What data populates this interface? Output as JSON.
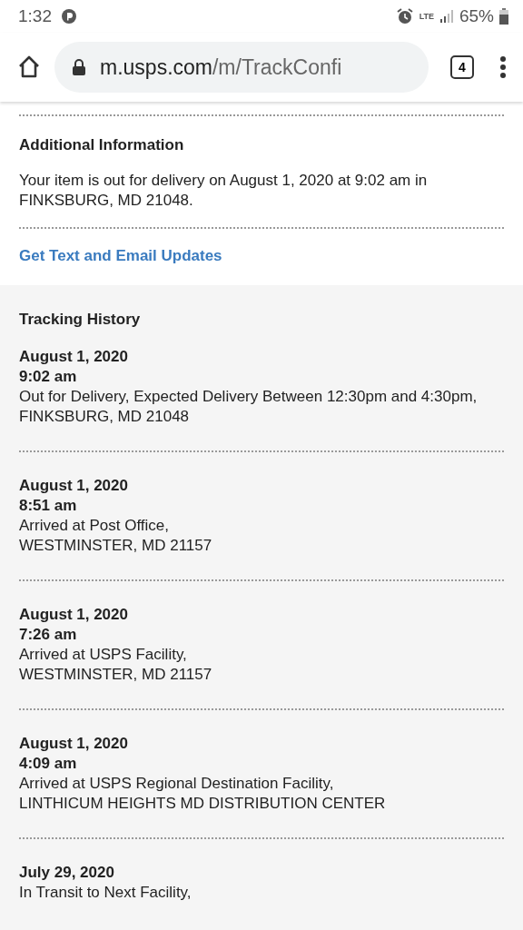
{
  "status_bar": {
    "time": "1:32",
    "network": "LTE",
    "battery": "65%"
  },
  "browser": {
    "url_host": "m.usps.com",
    "url_path": "/m/TrackConfi",
    "tab_count": "4"
  },
  "additional_information": {
    "title": "Additional Information",
    "text": "Your item is out for delivery on August 1, 2020 at 9:02 am in FINKSBURG, MD 21048.",
    "link": "Get Text and Email Updates"
  },
  "tracking_history": {
    "title": "Tracking History",
    "events": [
      {
        "date": "August 1, 2020",
        "time": "9:02 am",
        "status": "Out for Delivery, Expected Delivery Between 12:30pm and 4:30pm,",
        "location": "FINKSBURG, MD 21048"
      },
      {
        "date": "August 1, 2020",
        "time": "8:51 am",
        "status": "Arrived at Post Office,",
        "location": "WESTMINSTER, MD 21157"
      },
      {
        "date": "August 1, 2020",
        "time": "7:26 am",
        "status": "Arrived at USPS Facility,",
        "location": "WESTMINSTER, MD 21157"
      },
      {
        "date": "August 1, 2020",
        "time": "4:09 am",
        "status": "Arrived at USPS Regional Destination Facility,",
        "location": "LINTHICUM HEIGHTS MD DISTRIBUTION CENTER"
      },
      {
        "date": "July 29, 2020",
        "status": "In Transit to Next Facility,"
      }
    ]
  }
}
